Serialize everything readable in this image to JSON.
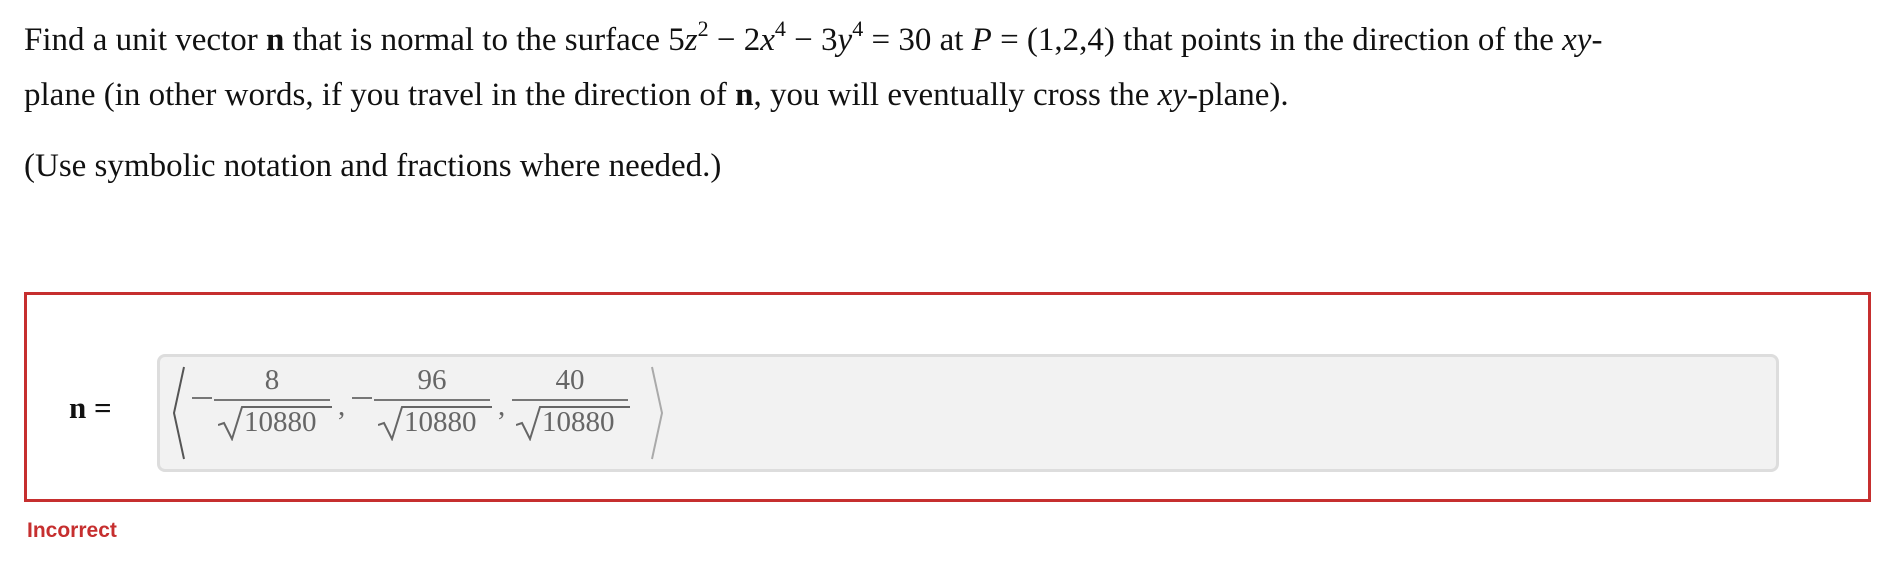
{
  "question": {
    "seg1": "Find a unit vector ",
    "n_symbol": "n",
    "seg2": " that is normal to the surface 5",
    "var_z": "z",
    "exp_z": "2",
    "seg3": " − 2",
    "var_x": "x",
    "exp_x": "4",
    "seg4": " − 3",
    "var_y": "y",
    "exp_y": "4",
    "seg5": " = 30 at ",
    "var_P": "P",
    "seg6": " = (1,2,4) that points in the direction of the ",
    "xy": "xy",
    "seg7": "-",
    "line2_a": "plane (in other words, if you travel in the direction of ",
    "line2_b": ", you will eventually cross the ",
    "line2_c": "-plane).",
    "instruction": "(Use symbolic notation and fractions where needed.)"
  },
  "answer": {
    "label": "n =",
    "components": [
      {
        "sign": "−",
        "numerator": "8",
        "denominator": "10880"
      },
      {
        "sign": "−",
        "numerator": "96",
        "denominator": "10880"
      },
      {
        "sign": "",
        "numerator": "40",
        "denominator": "10880"
      }
    ],
    "separator": ","
  },
  "feedback": {
    "status": "Incorrect",
    "color": "#c62f2f"
  }
}
